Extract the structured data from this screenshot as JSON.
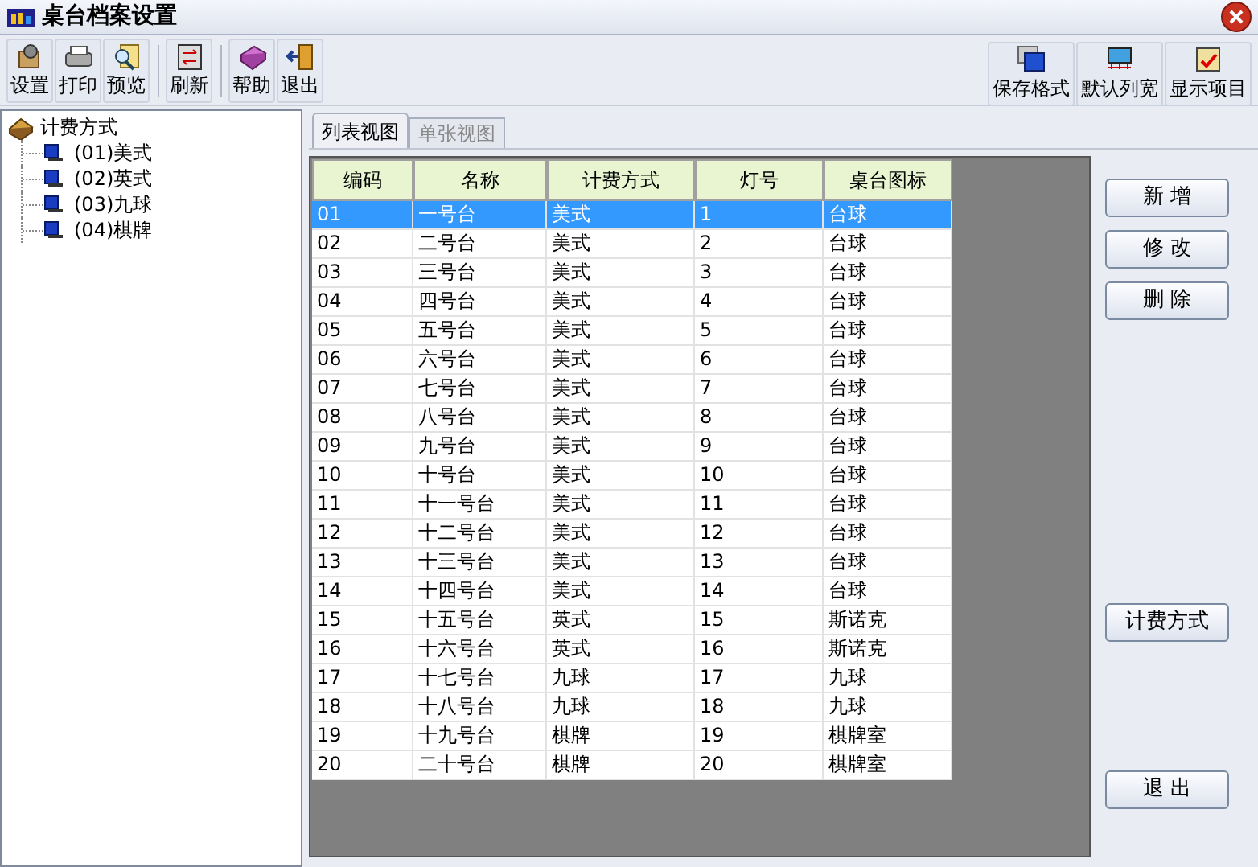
{
  "window": {
    "title": "桌台档案设置"
  },
  "toolbar": {
    "groups": [
      [
        "设置",
        "打印",
        "预览"
      ],
      [
        "刷新"
      ],
      [
        "帮助",
        "退出"
      ]
    ],
    "right": [
      "保存格式",
      "默认列宽",
      "显示项目"
    ]
  },
  "tree": {
    "label": "计费方式",
    "children": [
      {
        "label": "(01)美式"
      },
      {
        "label": "(02)英式"
      },
      {
        "label": "(03)九球"
      },
      {
        "label": "(04)棋牌"
      }
    ]
  },
  "tabs": [
    {
      "label": "列表视图",
      "selected": true
    },
    {
      "label": "单张视图",
      "selected": false
    }
  ],
  "table": {
    "columns": [
      "编码",
      "名称",
      "计费方式",
      "灯号",
      "桌台图标"
    ],
    "rows": [
      {
        "cells": [
          "01",
          "一号台",
          "美式",
          "1",
          "台球"
        ],
        "selected": true
      },
      {
        "cells": [
          "02",
          "二号台",
          "美式",
          "2",
          "台球"
        ],
        "selected": false
      },
      {
        "cells": [
          "03",
          "三号台",
          "美式",
          "3",
          "台球"
        ],
        "selected": false
      },
      {
        "cells": [
          "04",
          "四号台",
          "美式",
          "4",
          "台球"
        ],
        "selected": false
      },
      {
        "cells": [
          "05",
          "五号台",
          "美式",
          "5",
          "台球"
        ],
        "selected": false
      },
      {
        "cells": [
          "06",
          "六号台",
          "美式",
          "6",
          "台球"
        ],
        "selected": false
      },
      {
        "cells": [
          "07",
          "七号台",
          "美式",
          "7",
          "台球"
        ],
        "selected": false
      },
      {
        "cells": [
          "08",
          "八号台",
          "美式",
          "8",
          "台球"
        ],
        "selected": false
      },
      {
        "cells": [
          "09",
          "九号台",
          "美式",
          "9",
          "台球"
        ],
        "selected": false
      },
      {
        "cells": [
          "10",
          "十号台",
          "美式",
          "10",
          "台球"
        ],
        "selected": false
      },
      {
        "cells": [
          "11",
          "十一号台",
          "美式",
          "11",
          "台球"
        ],
        "selected": false
      },
      {
        "cells": [
          "12",
          "十二号台",
          "美式",
          "12",
          "台球"
        ],
        "selected": false
      },
      {
        "cells": [
          "13",
          "十三号台",
          "美式",
          "13",
          "台球"
        ],
        "selected": false
      },
      {
        "cells": [
          "14",
          "十四号台",
          "美式",
          "14",
          "台球"
        ],
        "selected": false
      },
      {
        "cells": [
          "15",
          "十五号台",
          "英式",
          "15",
          "斯诺克"
        ],
        "selected": false
      },
      {
        "cells": [
          "16",
          "十六号台",
          "英式",
          "16",
          "斯诺克"
        ],
        "selected": false
      },
      {
        "cells": [
          "17",
          "十七号台",
          "九球",
          "17",
          "九球"
        ],
        "selected": false
      },
      {
        "cells": [
          "18",
          "十八号台",
          "九球",
          "18",
          "九球"
        ],
        "selected": false
      },
      {
        "cells": [
          "19",
          "十九号台",
          "棋牌",
          "19",
          "棋牌室"
        ],
        "selected": false
      },
      {
        "cells": [
          "20",
          "二十号台",
          "棋牌",
          "20",
          "棋牌室"
        ],
        "selected": false
      }
    ]
  },
  "actions": {
    "top": [
      "新 增",
      "修 改",
      "删 除"
    ],
    "middle": "计费方式",
    "bottom": "退 出"
  }
}
